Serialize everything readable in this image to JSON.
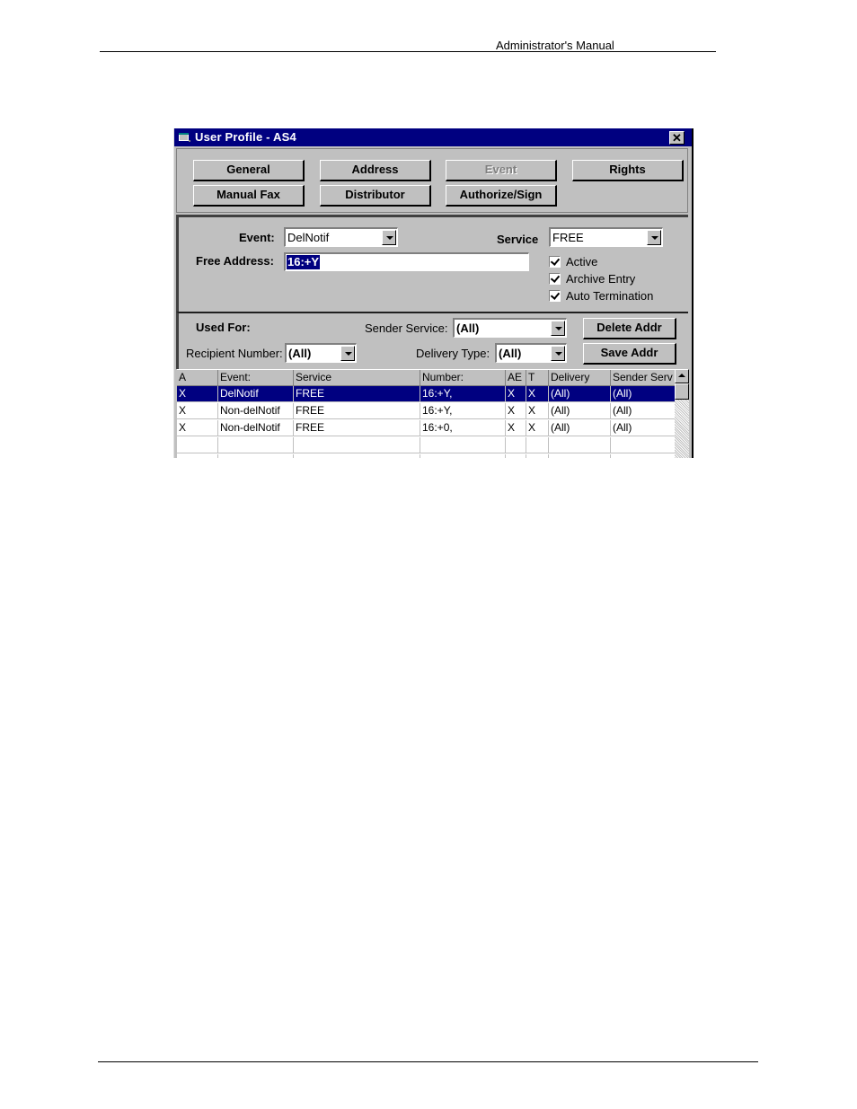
{
  "page": {
    "header_text": "Administrator's Manual"
  },
  "window": {
    "title": "User Profile - AS4",
    "close_label": "✕",
    "tabs": [
      {
        "label": "General",
        "enabled": true
      },
      {
        "label": "Address",
        "enabled": true
      },
      {
        "label": "Event",
        "enabled": false
      },
      {
        "label": "Rights",
        "enabled": true
      },
      {
        "label": "Manual Fax",
        "enabled": true
      },
      {
        "label": "Distributor",
        "enabled": true
      },
      {
        "label": "Authorize/Sign",
        "enabled": true
      }
    ]
  },
  "event_panel": {
    "event_label": "Event:",
    "event_value": "DelNotif",
    "service_label": "Service",
    "service_value": "FREE",
    "free_address_label": "Free Address:",
    "free_address_value": "16:+Y",
    "checkboxes": [
      {
        "label": "Active",
        "checked": true
      },
      {
        "label": "Archive Entry",
        "checked": true
      },
      {
        "label": "Auto Termination",
        "checked": true
      }
    ]
  },
  "filter_panel": {
    "used_for_label": "Used For:",
    "sender_service_label": "Sender Service:",
    "sender_service_value": "(All)",
    "recipient_number_label": "Recipient Number:",
    "recipient_number_value": "(All)",
    "delivery_type_label": "Delivery Type:",
    "delivery_type_value": "(All)",
    "delete_button": "Delete Addr",
    "save_button": "Save Addr"
  },
  "grid": {
    "columns": [
      "A",
      "Event:",
      "Service",
      "Number:",
      "AE",
      "T",
      "Delivery",
      "Sender Serv"
    ],
    "rows": [
      [
        "X",
        "DelNotif",
        "FREE",
        "16:+Y,",
        "X",
        "X",
        "(All)",
        "(All)"
      ],
      [
        "X",
        "Non-delNotif",
        "FREE",
        "16:+Y,",
        "X",
        "X",
        "(All)",
        "(All)"
      ],
      [
        "X",
        "Non-delNotif",
        "FREE",
        "16:+0,",
        "X",
        "X",
        "(All)",
        "(All)"
      ],
      [
        "",
        "",
        "",
        "",
        "",
        "",
        "",
        ""
      ],
      [
        "",
        "",
        "",
        "",
        "",
        "",
        "",
        ""
      ]
    ],
    "selected_row": 0
  }
}
